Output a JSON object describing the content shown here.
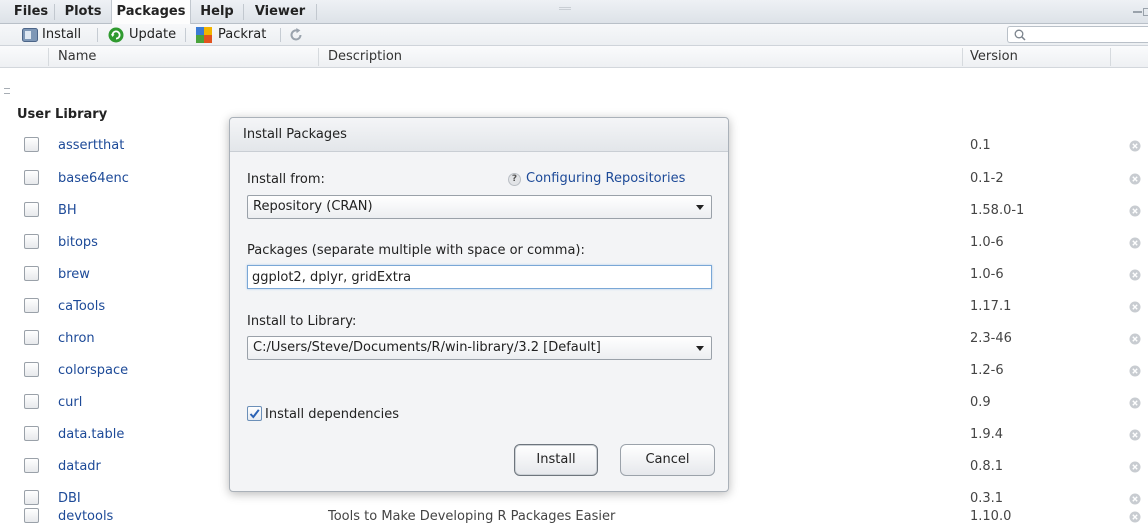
{
  "tabs": [
    {
      "label": "Files"
    },
    {
      "label": "Plots"
    },
    {
      "label": "Packages"
    },
    {
      "label": "Help"
    },
    {
      "label": "Viewer"
    }
  ],
  "toolbar": {
    "install_label": "Install",
    "update_label": "Update",
    "packrat_label": "Packrat",
    "search_placeholder": ""
  },
  "columns": {
    "name": "Name",
    "description": "Description",
    "version": "Version"
  },
  "library_label": "User Library",
  "packages": [
    {
      "name": "assertthat",
      "description": "",
      "version": "0.1"
    },
    {
      "name": "base64enc",
      "description": "",
      "version": "0.1-2"
    },
    {
      "name": "BH",
      "description": "",
      "version": "1.58.0-1"
    },
    {
      "name": "bitops",
      "description": "",
      "version": "1.0-6"
    },
    {
      "name": "brew",
      "description": "",
      "version": "1.0-6"
    },
    {
      "name": "caTools",
      "description": "",
      "version": "1.17.1"
    },
    {
      "name": "chron",
      "description": "",
      "version": "2.3-46"
    },
    {
      "name": "colorspace",
      "description": "",
      "version": "1.2-6"
    },
    {
      "name": "curl",
      "description": "",
      "version": "0.9"
    },
    {
      "name": "data.table",
      "description": "",
      "version": "1.9.4"
    },
    {
      "name": "datadr",
      "description": "",
      "version": "0.8.1"
    },
    {
      "name": "DBI",
      "description": "",
      "version": "0.3.1"
    },
    {
      "name": "devtools",
      "description": "Tools to Make Developing R Packages Easier",
      "version": "1.10.0"
    }
  ],
  "dialog": {
    "title": "Install Packages",
    "install_from_label": "Install from:",
    "help_link": "Configuring Repositories",
    "install_from_value": "Repository (CRAN)",
    "packages_label": "Packages (separate multiple with space or comma):",
    "packages_value": "ggplot2, dplyr, gridExtra",
    "library_label": "Install to Library:",
    "library_value": "C:/Users/Steve/Documents/R/win-library/3.2 [Default]",
    "dependencies_label": "Install dependencies",
    "dependencies_checked": true,
    "install_button": "Install",
    "cancel_button": "Cancel"
  },
  "colors": {
    "link": "#1d4a98",
    "update_icon": "#2f9a2f",
    "checkbox_check": "#2a62b5"
  },
  "icons": {
    "install": "install-icon",
    "update": "update-icon",
    "packrat": "packrat-icon",
    "refresh": "refresh-icon",
    "search": "search-icon",
    "remove": "remove-icon"
  }
}
